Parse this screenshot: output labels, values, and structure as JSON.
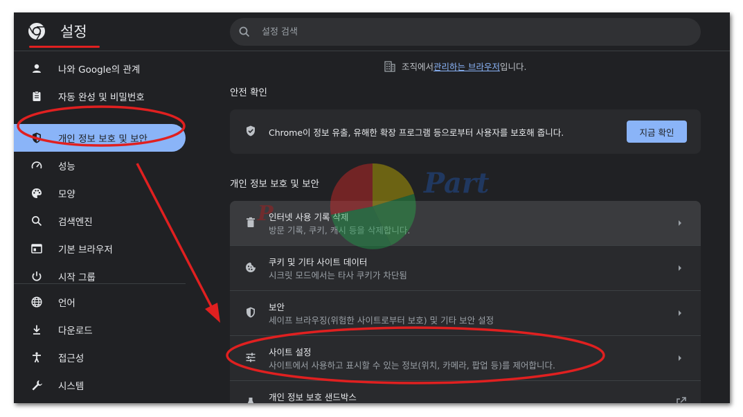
{
  "header": {
    "app_title": "설정",
    "logo_icon": "chrome-logo-icon",
    "search": {
      "placeholder": "설정 검색",
      "value": "",
      "icon": "search-icon"
    }
  },
  "sidebar": {
    "items": [
      {
        "label": "나와 Google의 관계",
        "icon": "person-icon",
        "active": false
      },
      {
        "label": "자동 완성 및 비밀번호",
        "icon": "clipboard-icon",
        "active": false
      },
      {
        "label": "개인 정보 보호 및 보안",
        "icon": "shield-icon",
        "active": true
      },
      {
        "label": "성능",
        "icon": "speedometer-icon",
        "active": false
      },
      {
        "label": "모양",
        "icon": "palette-icon",
        "active": false
      },
      {
        "label": "검색엔진",
        "icon": "search-icon",
        "active": false
      },
      {
        "label": "기본 브라우저",
        "icon": "browser-icon",
        "active": false
      },
      {
        "label": "시작 그룹",
        "icon": "power-icon",
        "active": false
      },
      {
        "label": "언어",
        "icon": "globe-icon",
        "active": false
      },
      {
        "label": "다운로드",
        "icon": "download-icon",
        "active": false
      },
      {
        "label": "접근성",
        "icon": "accessibility-icon",
        "active": false
      },
      {
        "label": "시스템",
        "icon": "wrench-icon",
        "active": false
      }
    ]
  },
  "managed_note": {
    "prefix": "조직에서 ",
    "link": "관리하는 브라우저",
    "suffix": "입니다."
  },
  "safety_check": {
    "section_title": "안전 확인",
    "text": "Chrome이 정보 유출, 유해한 확장 프로그램 등으로부터 사용자를 보호해 줍니다.",
    "button_label": "지금 확인"
  },
  "privacy": {
    "section_title": "개인 정보 보호 및 보안",
    "rows": [
      {
        "title": "인터넷 사용 기록 삭제",
        "subtitle": "방문 기록, 쿠키, 캐시 등을 삭제합니다.",
        "icon": "trash-icon"
      },
      {
        "title": "쿠키 및 기타 사이트 데이터",
        "subtitle": "시크릿 모드에서는 타사 쿠키가 차단됨",
        "icon": "cookie-icon"
      },
      {
        "title": "보안",
        "subtitle": "세이프 브라우징(위험한 사이트로부터 보호) 및 기타 보안 설정",
        "icon": "shield-icon"
      },
      {
        "title": "사이트 설정",
        "subtitle": "사이트에서 사용하고 표시할 수 있는 정보(위치, 카메라, 팝업 등)를 제어합니다.",
        "icon": "sliders-icon"
      },
      {
        "title": "개인 정보 보호 샌드박스",
        "subtitle": "",
        "icon": "flask-icon"
      }
    ]
  },
  "watermark": {
    "text": "Part"
  },
  "colors": {
    "accent": "#8ab4f8",
    "annotation": "#e02020",
    "background": "#202124",
    "card": "#292a2d"
  }
}
